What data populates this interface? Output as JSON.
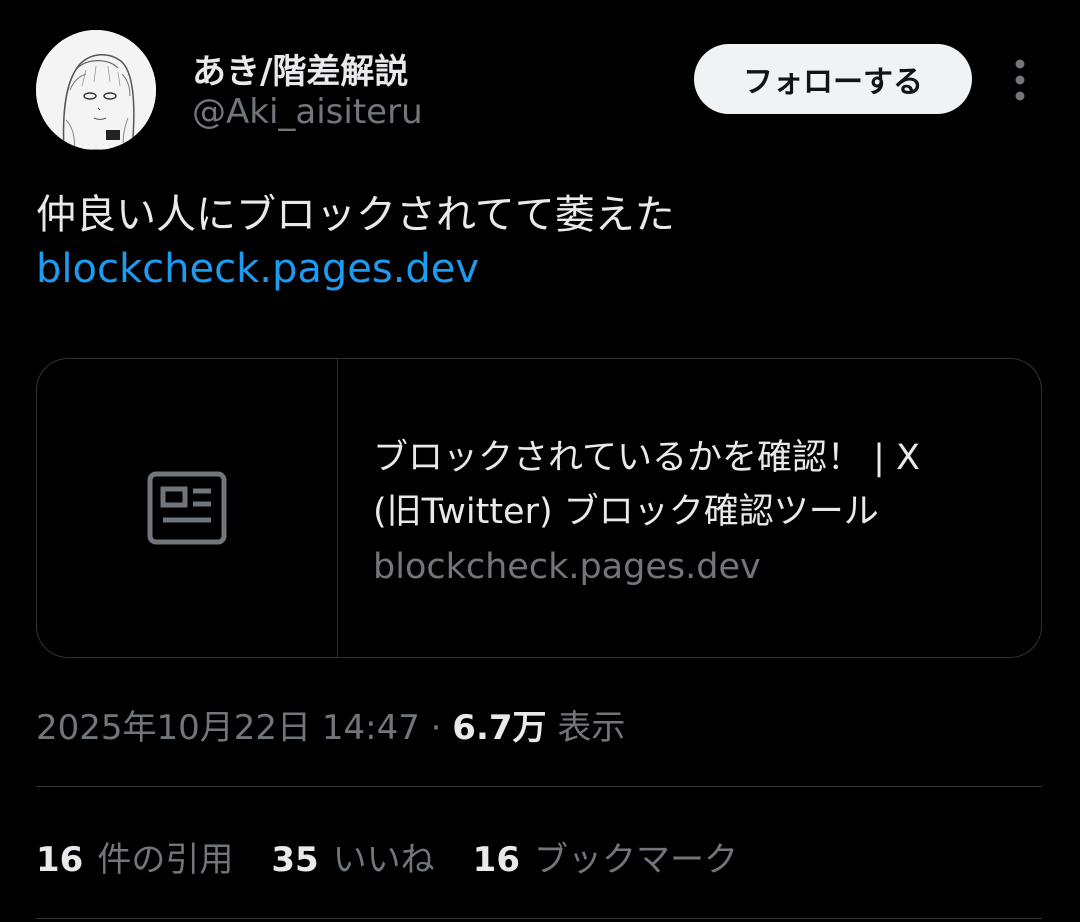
{
  "author": {
    "display_name": "あき/階差解説",
    "handle": "@Aki_aisiteru"
  },
  "header": {
    "follow_label": "フォローする",
    "more_icon": "more-vertical-icon"
  },
  "tweet": {
    "text": "仲良い人にブロックされてて萎えた",
    "link_text": "blockcheck.pages.dev"
  },
  "card": {
    "thumb_icon": "article-icon",
    "title_line1": "ブロックされているかを確認！ | X",
    "title_line2": "(旧Twitter) ブロック確認ツール",
    "domain": "blockcheck.pages.dev"
  },
  "meta": {
    "timestamp": "2025年10月22日 14:47",
    "separator": "·",
    "views_count": "6.7万",
    "views_label": "表示"
  },
  "stats": {
    "quotes_count": "16",
    "quotes_label": "件の引用",
    "likes_count": "35",
    "likes_label": "いいね",
    "bookmarks_count": "16",
    "bookmarks_label": "ブックマーク"
  },
  "colors": {
    "background": "#000000",
    "text_primary": "#e7e9ea",
    "text_secondary": "#71767b",
    "link": "#1d9bf0",
    "border": "#2f3336",
    "follow_button_bg": "#eff3f4"
  }
}
